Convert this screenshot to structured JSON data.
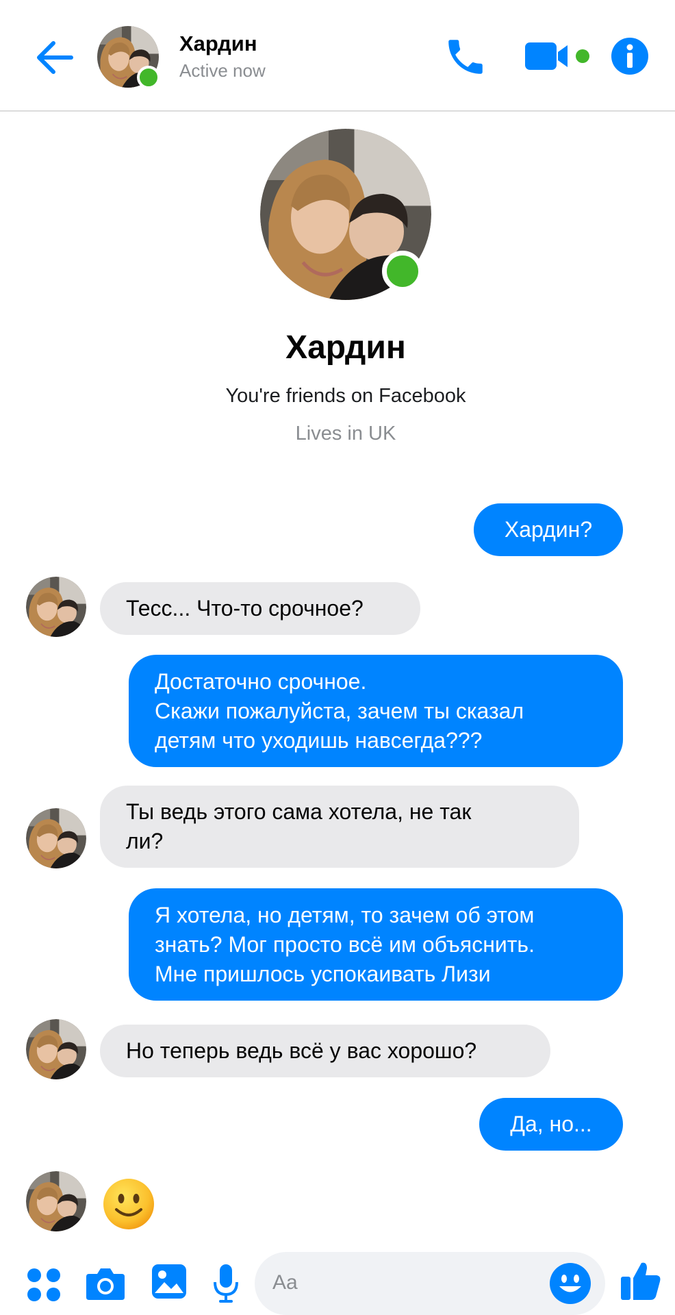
{
  "header": {
    "contact_name": "Хардин",
    "status": "Active now"
  },
  "profile": {
    "name": "Хардин",
    "friends_text": "You're friends on Facebook",
    "lives_text": "Lives in UK"
  },
  "messages": [
    {
      "direction": "out",
      "text": "Хардин?"
    },
    {
      "direction": "in",
      "text": "Тесс... Что-то срочное?"
    },
    {
      "direction": "out",
      "text": "Достаточно срочное.\nСкажи пожалуйста, зачем ты сказал\nдетям что уходишь навсегда???"
    },
    {
      "direction": "in",
      "text": "Ты ведь этого сама хотела, не так\nли?"
    },
    {
      "direction": "out",
      "text": "Я хотела, но детям, то зачем об этом\nзнать? Мог просто всё им объяснить.\nМне пришлось успокаивать Лизи"
    },
    {
      "direction": "in",
      "text": "Но теперь ведь всё у вас хорошо?"
    },
    {
      "direction": "out",
      "text": "Да, но..."
    },
    {
      "direction": "in",
      "emoji": "slightly-smiling-face"
    }
  ],
  "composer": {
    "placeholder": "Aa"
  },
  "colors": {
    "accent": "#0084ff",
    "online": "#42b72a",
    "incoming_bubble": "#e9e9eb",
    "composer_bg": "#f0f2f5"
  },
  "icons": {
    "back": "arrow-left-icon",
    "call": "phone-icon",
    "video": "video-camera-icon",
    "info": "info-icon",
    "apps": "four-dots-icon",
    "camera": "camera-icon",
    "gallery": "image-icon",
    "mic": "microphone-icon",
    "emoji": "smiley-icon",
    "like": "thumbs-up-icon"
  }
}
